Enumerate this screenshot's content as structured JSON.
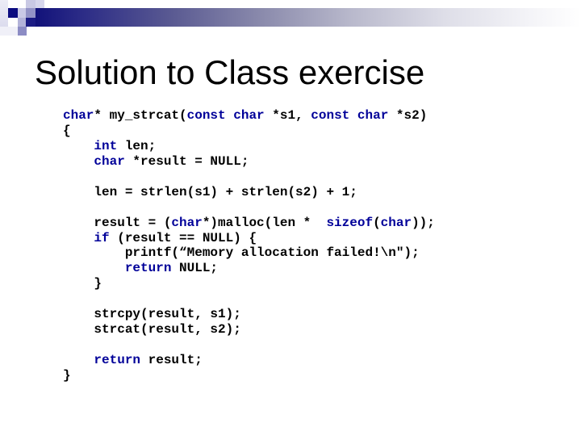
{
  "slide": {
    "title": "Solution to Class exercise",
    "colors": {
      "keyword": "#000099",
      "text": "#000000",
      "header_bar_start": "#12127a",
      "header_bar_end": "#ffffff"
    },
    "code": {
      "language": "c",
      "lines": [
        [
          {
            "t": "char",
            "kw": true
          },
          {
            "t": "* my_strcat("
          },
          {
            "t": "const",
            "kw": true
          },
          {
            "t": " "
          },
          {
            "t": "char",
            "kw": true
          },
          {
            "t": " *s1, "
          },
          {
            "t": "const",
            "kw": true
          },
          {
            "t": " "
          },
          {
            "t": "char",
            "kw": true
          },
          {
            "t": " *s2)"
          }
        ],
        [
          {
            "t": "{"
          }
        ],
        [
          {
            "t": "    "
          },
          {
            "t": "int",
            "kw": true
          },
          {
            "t": " len;"
          }
        ],
        [
          {
            "t": "    "
          },
          {
            "t": "char",
            "kw": true
          },
          {
            "t": " *result = NULL;"
          }
        ],
        [],
        [
          {
            "t": "    len = strlen(s1) + strlen(s2) + 1;"
          }
        ],
        [],
        [
          {
            "t": "    result = ("
          },
          {
            "t": "char",
            "kw": true
          },
          {
            "t": "*)malloc(len *  "
          },
          {
            "t": "sizeof",
            "kw": true
          },
          {
            "t": "("
          },
          {
            "t": "char",
            "kw": true
          },
          {
            "t": "));"
          }
        ],
        [
          {
            "t": "    "
          },
          {
            "t": "if",
            "kw": true
          },
          {
            "t": " (result == NULL) {"
          }
        ],
        [
          {
            "t": "        printf(“Memory allocation failed!\\n\");"
          }
        ],
        [
          {
            "t": "        "
          },
          {
            "t": "return",
            "kw": true
          },
          {
            "t": " NULL;"
          }
        ],
        [
          {
            "t": "    }"
          }
        ],
        [],
        [
          {
            "t": "    strcpy(result, s1);"
          }
        ],
        [
          {
            "t": "    strcat(result, s2);"
          }
        ],
        [],
        [
          {
            "t": "    "
          },
          {
            "t": "return",
            "kw": true
          },
          {
            "t": " result;"
          }
        ],
        [
          {
            "t": "}"
          }
        ]
      ]
    }
  }
}
